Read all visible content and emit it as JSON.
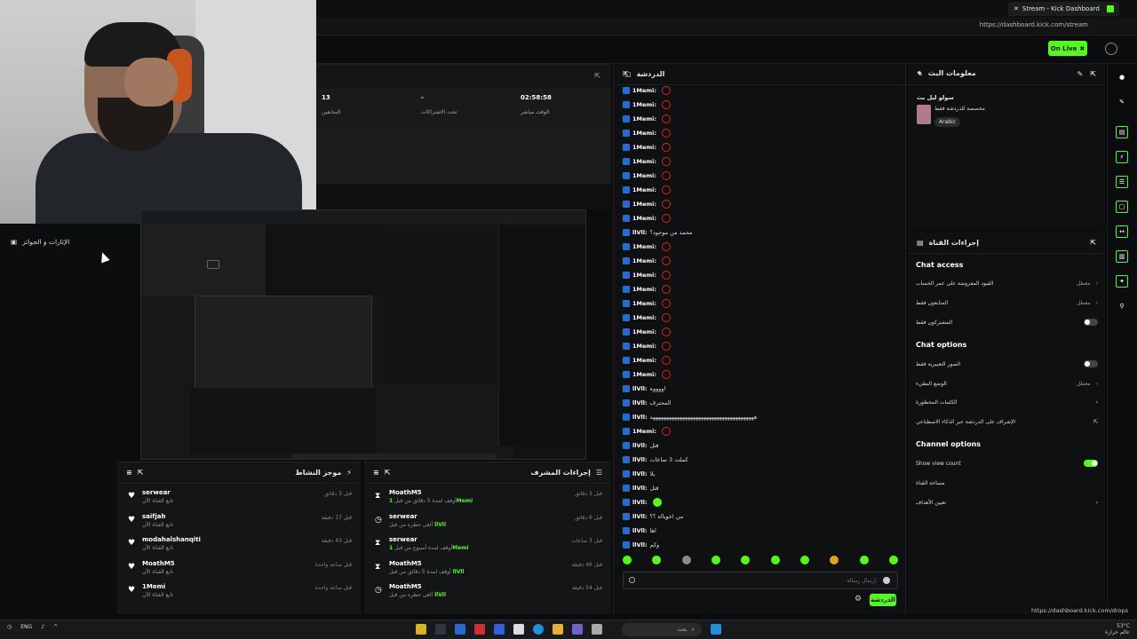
{
  "browser": {
    "tab_title": "Stream - Kick Dashboard",
    "url": "https://dashboard.kick.com/stream",
    "go_live_label": "On Live"
  },
  "left_nav": {
    "item": "الإثارات و الجوائز"
  },
  "stats": {
    "followers_value": "13",
    "followers_label": "المتابعين",
    "subs_value": "-",
    "subs_label": "تحدد الاشتراكات",
    "time_value": "02:58:58",
    "time_label": "الوقت مباشر"
  },
  "activity": {
    "title": "موجز النشاط",
    "items": [
      {
        "name": "serwear",
        "sub": "تابع القناة الآن",
        "time": "قبل 3 دقائق"
      },
      {
        "name": "saifjah",
        "sub": "تابع القناة الآن",
        "time": "قبل 17 دقيقة"
      },
      {
        "name": "modahalshanqiti",
        "sub": "تابع القناة الآن",
        "time": "قبل 43 دقيقة"
      },
      {
        "name": "MoathM5",
        "sub": "تابع القناة الآن",
        "time": "قبل ساعة واحدة"
      },
      {
        "name": "1Memi",
        "sub": "تابع القناة الآن",
        "time": "قبل ساعة واحدة"
      }
    ]
  },
  "mod_actions": {
    "title": "إجراءات المشرف",
    "items": [
      {
        "name": "MoathM5",
        "sub": "أوقف لمدة 5 دقائق من قبل",
        "target": "1Memi",
        "time": "قبل 3 دقائق"
      },
      {
        "name": "serwear",
        "sub": "ألغى حظره من قبل",
        "target": "llVll",
        "time": "قبل 6 دقائق"
      },
      {
        "name": "serwear",
        "sub": "أوقف لمدة أسبوع من قبل",
        "target": "1Memi",
        "time": "قبل 3 ساعات"
      },
      {
        "name": "MoathM5",
        "sub": "أوقف لمدة 5 دقائق من قبل",
        "target": "llVll",
        "time": "قبل 46 دقيقة"
      },
      {
        "name": "MoathM5",
        "sub": "ألغى حظره من قبل",
        "target": "llVll",
        "time": "قبل 54 دقيقة"
      }
    ]
  },
  "chat": {
    "title": "الدردشة",
    "messages": [
      {
        "user": "1Memi:",
        "text": "",
        "heart": true
      },
      {
        "user": "1Memi:",
        "text": "",
        "heart": true
      },
      {
        "user": "1Memi:",
        "text": "",
        "heart": true
      },
      {
        "user": "1Memi:",
        "text": "",
        "heart": true
      },
      {
        "user": "1Memi:",
        "text": "",
        "heart": true
      },
      {
        "user": "1Memi:",
        "text": "",
        "heart": true
      },
      {
        "user": "1Memi:",
        "text": "",
        "heart": true
      },
      {
        "user": "1Memi:",
        "text": "",
        "heart": true
      },
      {
        "user": "1Memi:",
        "text": "",
        "heart": true
      },
      {
        "user": "1Memi:",
        "text": "",
        "heart": true
      },
      {
        "user": "llVll:",
        "text": "محمد من موجود؟",
        "heart": false
      },
      {
        "user": "1Memi:",
        "text": "",
        "heart": true
      },
      {
        "user": "1Memi:",
        "text": "",
        "heart": true
      },
      {
        "user": "1Memi:",
        "text": "",
        "heart": true
      },
      {
        "user": "1Memi:",
        "text": "",
        "heart": true
      },
      {
        "user": "1Memi:",
        "text": "",
        "heart": true
      },
      {
        "user": "1Memi:",
        "text": "",
        "heart": true
      },
      {
        "user": "1Memi:",
        "text": "",
        "heart": true
      },
      {
        "user": "1Memi:",
        "text": "",
        "heart": true
      },
      {
        "user": "1Memi:",
        "text": "",
        "heart": true
      },
      {
        "user": "1Memi:",
        "text": "",
        "heart": true
      },
      {
        "user": "llVll:",
        "text": "اووووه",
        "heart": false
      },
      {
        "user": "llVll:",
        "text": "المحترف",
        "heart": false
      },
      {
        "user": "llVll:",
        "text": "هههههههههههههههههههههههههههههههههههههههه",
        "heart": false
      },
      {
        "user": "1Memi:",
        "text": "",
        "heart": true
      },
      {
        "user": "llVll:",
        "text": "قتل",
        "heart": false
      },
      {
        "user": "llVll:",
        "text": "كملت 3 ساعات",
        "heart": false
      },
      {
        "user": "llVll:",
        "text": "يلا",
        "heart": false
      },
      {
        "user": "llVll:",
        "text": "قتل",
        "heart": false
      },
      {
        "user": "llVll:",
        "text": "",
        "heart": false,
        "smile": true
      },
      {
        "user": "llVll:",
        "text": "من اخويااه ؟؟",
        "heart": false
      },
      {
        "user": "llVll:",
        "text": "اها",
        "heart": false
      },
      {
        "user": "llVll:",
        "text": "وكم",
        "heart": false
      }
    ],
    "input_placeholder": "إرسال رسالة",
    "send_label": "الدردشة"
  },
  "stream_info": {
    "title": "معلومات البث",
    "stream_title": "سولو ليل بث",
    "category": "مخصصة للدردشة فقط",
    "language": "Arabic"
  },
  "channel_actions": {
    "title": "إجراءات القناة",
    "chat_access": "Chat access",
    "account_age": "القيود المفروضة على عمر الحساب",
    "account_age_value": "معطل",
    "followers_only": "المتابعون فقط",
    "followers_only_value": "معطل",
    "subs_only": "المشتركون فقط",
    "chat_options": "Chat options",
    "emote_only": "الصور التعبيرية فقط",
    "slow_mode": "الوضع البطيء",
    "slow_mode_value": "معطل",
    "banned_words": "الكلمات المحظورة",
    "ai_moderation": "الإشراف على الدردشة عبر الذكاء الاصطناعي",
    "channel_options": "Channel options",
    "show_view_count": "Show view count",
    "channel_clip": "مساحة القناة",
    "set_goals": "تعيين الأهداف"
  },
  "taskbar": {
    "lang": "ENG",
    "search": "بحث",
    "time": "53°C",
    "date": "عالم حرارة"
  },
  "status_url": "https://dashboard.kick.com/drops",
  "colors": {
    "accent": "#53fc18",
    "bg": "#0f1011"
  }
}
